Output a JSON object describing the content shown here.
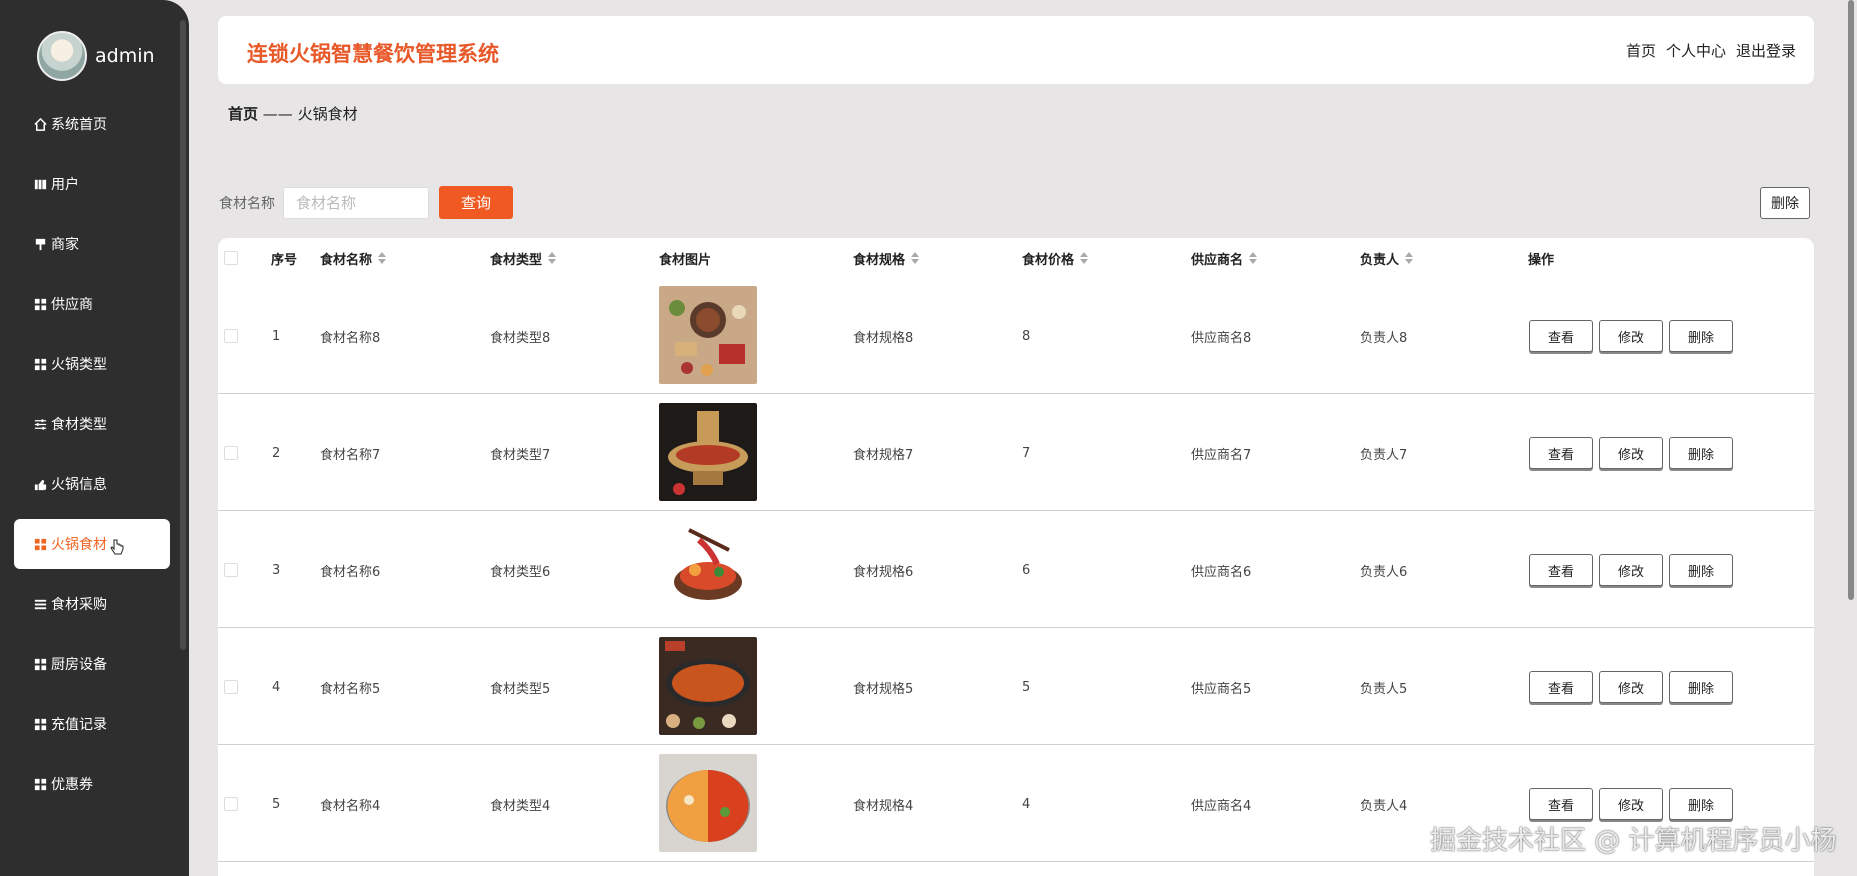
{
  "sidebar": {
    "username": "admin",
    "items": [
      {
        "label": "系统首页",
        "icon": "home-icon"
      },
      {
        "label": "用户",
        "icon": "book-icon"
      },
      {
        "label": "商家",
        "icon": "shop-icon"
      },
      {
        "label": "供应商",
        "icon": "grid-icon"
      },
      {
        "label": "火锅类型",
        "icon": "grid-icon"
      },
      {
        "label": "食材类型",
        "icon": "sliders-icon"
      },
      {
        "label": "火锅信息",
        "icon": "hand-icon"
      },
      {
        "label": "火锅食材",
        "icon": "grid-icon",
        "active": true
      },
      {
        "label": "食材采购",
        "icon": "list-icon"
      },
      {
        "label": "厨房设备",
        "icon": "grid-icon"
      },
      {
        "label": "充值记录",
        "icon": "grid-icon"
      },
      {
        "label": "优惠券",
        "icon": "grid-icon"
      }
    ]
  },
  "header": {
    "title": "连锁火锅智慧餐饮管理系统",
    "nav": [
      "首页",
      "个人中心",
      "退出登录"
    ]
  },
  "breadcrumb": {
    "home": "首页",
    "separator": "——",
    "current": "火锅食材"
  },
  "search": {
    "label": "食材名称",
    "placeholder": "食材名称",
    "button": "查询"
  },
  "toolbar": {
    "delete_label": "删除"
  },
  "table": {
    "headers": {
      "index": "序号",
      "name": "食材名称",
      "type": "食材类型",
      "image": "食材图片",
      "spec": "食材规格",
      "price": "食材价格",
      "supplier": "供应商名",
      "owner": "负责人",
      "actions": "操作"
    },
    "actions": {
      "view": "查看",
      "edit": "修改",
      "delete": "删除"
    },
    "rows": [
      {
        "index": "1",
        "name": "食材名称8",
        "type": "食材类型8",
        "spec": "食材规格8",
        "price": "8",
        "supplier": "供应商名8",
        "owner": "负责人8"
      },
      {
        "index": "2",
        "name": "食材名称7",
        "type": "食材类型7",
        "spec": "食材规格7",
        "price": "7",
        "supplier": "供应商名7",
        "owner": "负责人7"
      },
      {
        "index": "3",
        "name": "食材名称6",
        "type": "食材类型6",
        "spec": "食材规格6",
        "price": "6",
        "supplier": "供应商名6",
        "owner": "负责人6"
      },
      {
        "index": "4",
        "name": "食材名称5",
        "type": "食材类型5",
        "spec": "食材规格5",
        "price": "5",
        "supplier": "供应商名5",
        "owner": "负责人5"
      },
      {
        "index": "5",
        "name": "食材名称4",
        "type": "食材类型4",
        "spec": "食材规格4",
        "price": "4",
        "supplier": "供应商名4",
        "owner": "负责人4"
      }
    ]
  },
  "colors": {
    "accent": "#f05a22",
    "title": "#e8592a",
    "sidebar_bg": "#2e2e2e"
  },
  "watermark": "掘金技术社区 @ 计算机程序员小杨"
}
